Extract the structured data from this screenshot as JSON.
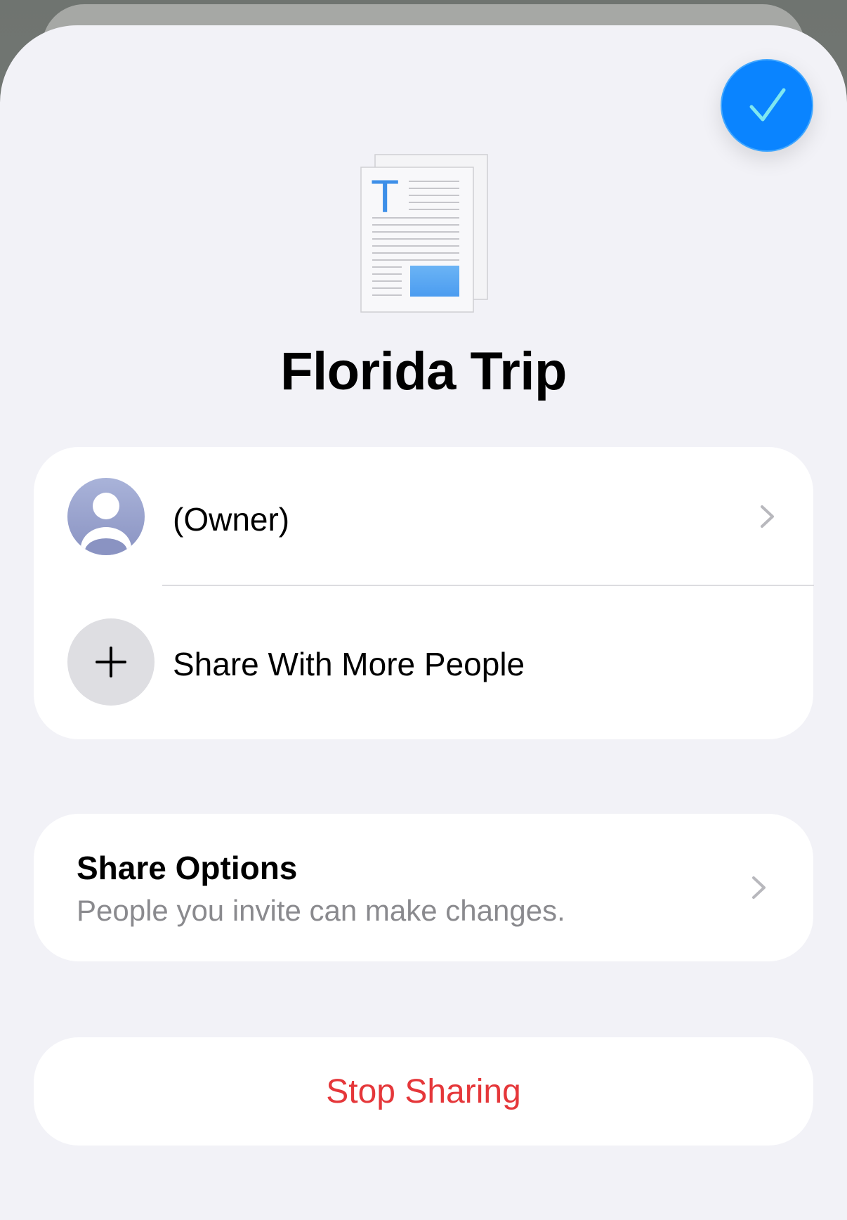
{
  "app": {
    "accent_color": "#0a84ff",
    "destructive_color": "#e5373a"
  },
  "header": {
    "done_icon": "checkmark-icon",
    "document_icon": "text-document-icon"
  },
  "document": {
    "title": "Florida Trip"
  },
  "participants": {
    "owner": {
      "label": "(Owner)",
      "avatar_icon": "person-silhouette-icon"
    },
    "add": {
      "label": "Share With More People",
      "icon": "plus-icon"
    }
  },
  "share_options": {
    "title": "Share Options",
    "subtitle": "People you invite can make changes."
  },
  "actions": {
    "stop_sharing_label": "Stop Sharing"
  }
}
